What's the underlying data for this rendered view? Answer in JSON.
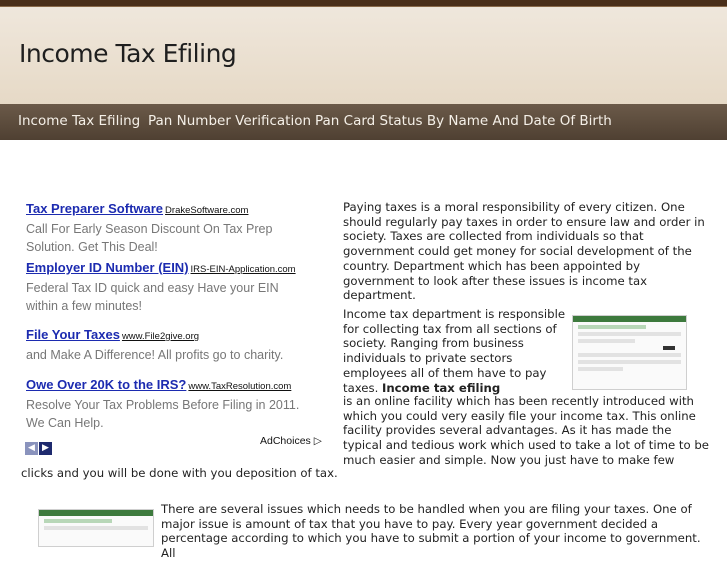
{
  "site": {
    "title": "Income Tax Efiling"
  },
  "nav": [
    {
      "label": "Income Tax Efiling"
    },
    {
      "label": "Pan Number Verification"
    },
    {
      "label": "Pan Card Status By Name And Date Of Birth"
    }
  ],
  "ads": [
    {
      "title": "Tax Preparer Software",
      "url": "DrakeSoftware.com",
      "desc": "Call For Early Season Discount On Tax Prep Solution. Get This Deal!"
    },
    {
      "title": "Employer ID Number (EIN)",
      "url": "IRS-EIN-Application.com",
      "desc": "Federal Tax ID quick and easy Have your EIN within a few minutes!"
    },
    {
      "title": "File Your Taxes",
      "url": "www.File2give.org",
      "desc": "and Make A Difference! All profits go to charity."
    },
    {
      "title": "Owe Over 20K to the IRS?",
      "url": "www.TaxResolution.com",
      "desc": "Resolve Your Tax Problems Before Filing in 2011. We Can Help."
    }
  ],
  "adchoices": "AdChoices",
  "content": {
    "p1": "Paying taxes is a moral responsibility of every citizen. One should regularly pay taxes in order to ensure law and order in society. Taxes are collected from individuals so that government could get money for social development of the country. Department which has been appointed by government to look after these issues is income tax department.",
    "p2_a": "Income tax department is responsible for collecting tax from all sections of society. Ranging from business individuals to private sectors employees all of them have to pay taxes.",
    "p2_bold": "Income tax efiling",
    "p2_b": "is an online facility which has been recently introduced with which you could very easily file your income tax. This online facility provides several advantages. As it has made the typical and tedious work which used to take a lot of time to be much easier and simple. Now you just have to make few",
    "p2_c": "clicks and you will be done with you deposition of tax.",
    "p3": "There are several issues which needs to be handled when you are filing your taxes. One of major issue is amount of tax that you have to pay. Every year government decided a percentage according to which you have to submit a portion of your income to government. All"
  }
}
